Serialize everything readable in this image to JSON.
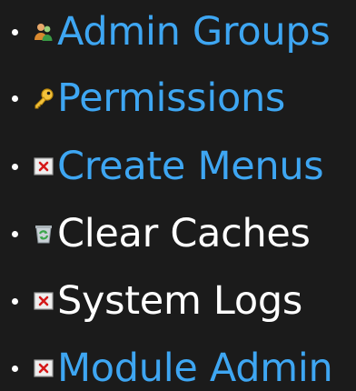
{
  "menu": {
    "items": [
      {
        "label": "Admin Groups",
        "icon": "user-group-icon",
        "is_link": true
      },
      {
        "label": "Permissions",
        "icon": "key-icon",
        "is_link": true
      },
      {
        "label": "Create Menus",
        "icon": "broken-image-icon",
        "is_link": true
      },
      {
        "label": "Clear Caches",
        "icon": "recycle-icon",
        "is_link": false
      },
      {
        "label": "System Logs",
        "icon": "broken-image-icon",
        "is_link": false
      },
      {
        "label": "Module Admin",
        "icon": "broken-image-icon",
        "is_link": true
      }
    ]
  },
  "colors": {
    "background": "#1b1b1b",
    "link": "#3ea6f2",
    "plain_text": "#ffffff"
  }
}
